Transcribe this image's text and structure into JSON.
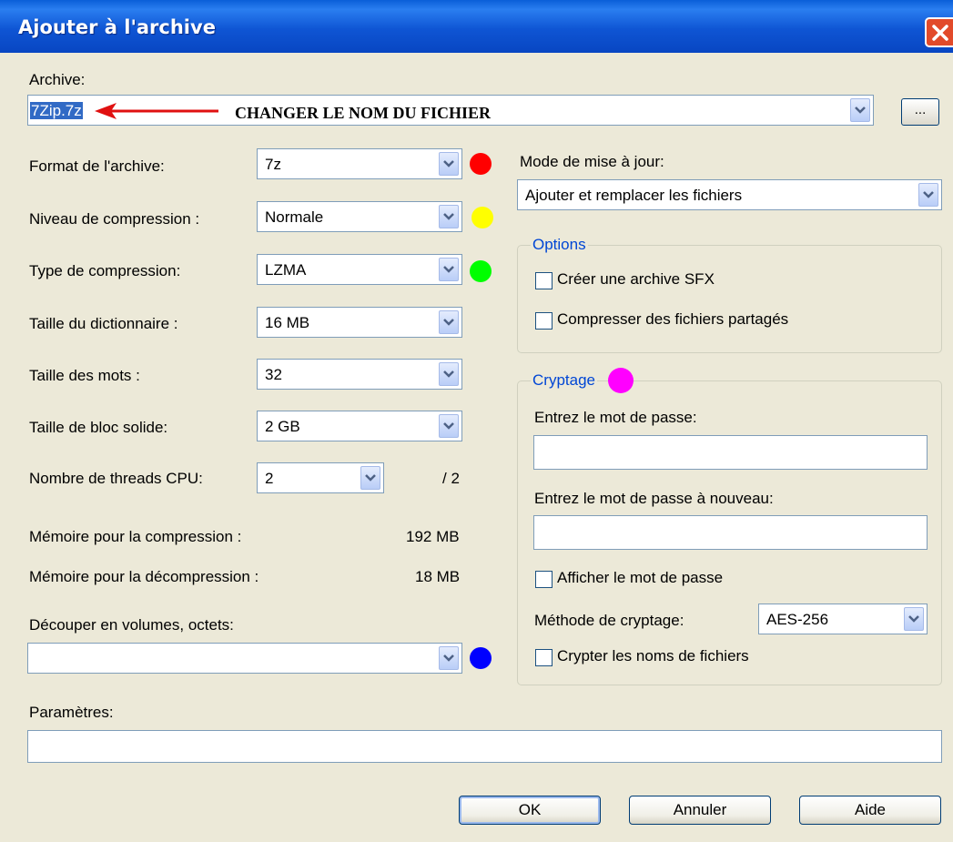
{
  "window": {
    "title": "Ajouter à l'archive"
  },
  "archive": {
    "label": "Archive:",
    "value": "7Zip.7z",
    "browse_label": "...",
    "annotation": "CHANGER LE NOM DU FICHIER"
  },
  "left": {
    "format": {
      "label": "Format de l'archive:",
      "value": "7z",
      "marker_color": "#ff0000"
    },
    "level": {
      "label": "Niveau de compression :",
      "value": "Normale",
      "marker_color": "#ffff00"
    },
    "type": {
      "label": "Type de compression:",
      "value": "LZMA",
      "marker_color": "#00ff00"
    },
    "dict": {
      "label": "Taille du dictionnaire :",
      "value": "16 MB"
    },
    "word": {
      "label": "Taille des mots :",
      "value": "32"
    },
    "block": {
      "label": "Taille de bloc solide:",
      "value": "2 GB"
    },
    "threads": {
      "label": "Nombre de threads CPU:",
      "value": "2",
      "max": "/ 2"
    },
    "mem_comp": {
      "label": "Mémoire pour la compression :",
      "value": "192 MB"
    },
    "mem_decomp": {
      "label": "Mémoire pour la décompression :",
      "value": "18 MB"
    },
    "split": {
      "label": "Découper en volumes, octets:",
      "value": "",
      "marker_color": "#0000ff"
    }
  },
  "params": {
    "label": "Paramètres:",
    "value": ""
  },
  "update": {
    "label": "Mode de mise à jour:",
    "value": "Ajouter et remplacer les fichiers"
  },
  "options": {
    "legend": "Options",
    "sfx": "Créer une archive SFX",
    "shared": "Compresser des fichiers partagés"
  },
  "encryption": {
    "legend": "Cryptage",
    "marker_color": "#ff00ff",
    "pwd_label": "Entrez le mot de passe:",
    "pwd2_label": "Entrez le mot de passe à nouveau:",
    "show_pwd": "Afficher le mot de passe",
    "method_label": "Méthode de cryptage:",
    "method_value": "AES-256",
    "encrypt_names": "Crypter les noms de fichiers"
  },
  "buttons": {
    "ok": "OK",
    "cancel": "Annuler",
    "help": "Aide"
  }
}
